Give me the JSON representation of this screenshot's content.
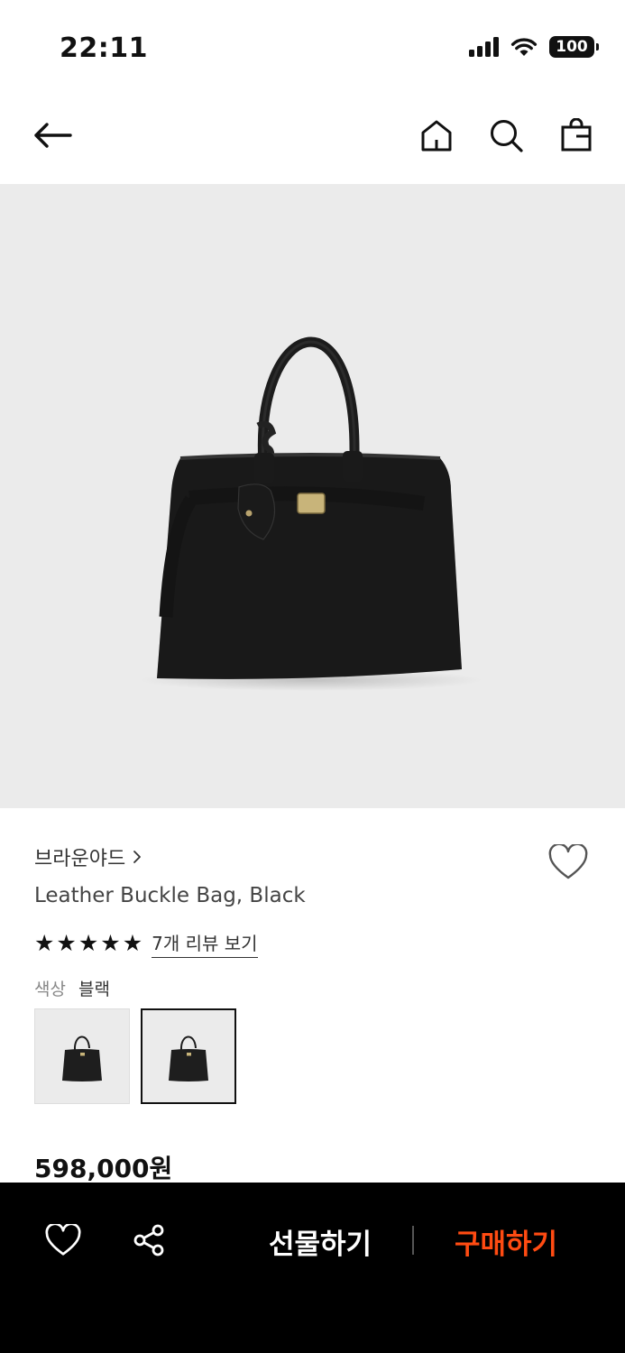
{
  "status_bar": {
    "time": "22:11",
    "battery": "100"
  },
  "nav": {
    "back_icon": "arrow-left-icon",
    "home_icon": "home-icon",
    "search_icon": "search-icon",
    "cart_icon": "shopping-bag-icon"
  },
  "product": {
    "brand": "브라운야드",
    "name": "Leather Buckle Bag, Black",
    "rating_stars": 5,
    "review_link": "7개 리뷰 보기",
    "color_label": "색상",
    "color_value": "블랙",
    "price": "598,000원",
    "selected_thumbnail": 2,
    "thumbnail_count": 2
  },
  "bottom_bar": {
    "gift_label": "선물하기",
    "buy_label": "구매하기",
    "buy_color": "#ff4b12"
  }
}
